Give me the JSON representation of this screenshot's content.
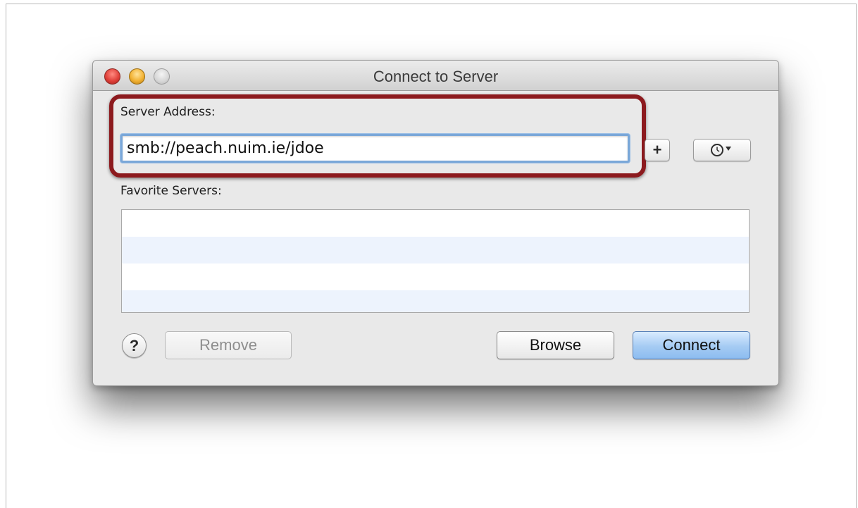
{
  "window": {
    "title": "Connect to Server"
  },
  "server_address": {
    "label": "Server Address:",
    "value": "smb://peach.nuim.ie/jdoe"
  },
  "favorites": {
    "label": "Favorite Servers:",
    "items": []
  },
  "buttons": {
    "add_label": "+",
    "help_label": "?",
    "remove_label": "Remove",
    "browse_label": "Browse",
    "connect_label": "Connect"
  },
  "icons": {
    "add": "plus-icon",
    "recent_servers": "clock-icon",
    "dropdown": "chevron-down-icon",
    "help": "question-mark-icon"
  },
  "colors": {
    "highlight": "#8c1a1e",
    "focus_ring": "#7aa7d8",
    "default_button": "#a5cbf3"
  }
}
